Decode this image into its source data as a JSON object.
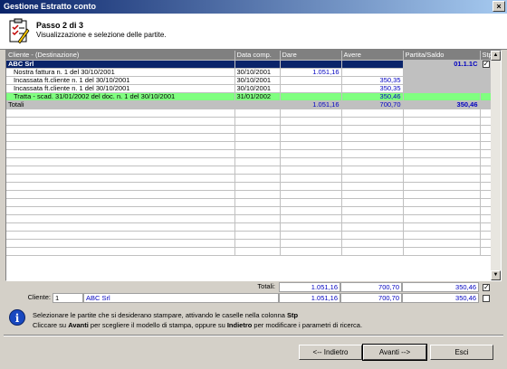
{
  "window": {
    "title": "Gestione Estratto conto",
    "close_label": "×"
  },
  "header": {
    "step_title": "Passo 2 di 3",
    "step_subtitle": "Visualizzazione e selezione delle partite."
  },
  "grid": {
    "columns": {
      "cliente": "Cliente - (Destinazione)",
      "data": "Data comp.",
      "dare": "Dare",
      "avere": "Avere",
      "saldo": "Partita/Saldo",
      "stp": "Stp"
    },
    "group": {
      "cliente": "ABC Srl",
      "saldo": "01.1.1C",
      "stp_checked": true
    },
    "rows": [
      {
        "cliente": "Nostra fattura n. 1 del 30/10/2001",
        "data": "30/10/2001",
        "dare": "1.051,16",
        "avere": "",
        "saldo": ""
      },
      {
        "cliente": "Incassata ft.cliente n. 1 del 30/10/2001",
        "data": "30/10/2001",
        "dare": "",
        "avere": "350,35",
        "saldo": ""
      },
      {
        "cliente": "Incassata ft.cliente n. 1 del 30/10/2001",
        "data": "30/10/2001",
        "dare": "",
        "avere": "350,35",
        "saldo": ""
      },
      {
        "cliente": "Tratta - scad. 31/01/2002 del doc. n. 1 del 30/10/2001",
        "data": "31/01/2002",
        "dare": "",
        "avere": "350,46",
        "saldo": ""
      }
    ],
    "totals": {
      "label": "Totali",
      "dare": "1.051,16",
      "avere": "700,70",
      "saldo": "350,46"
    }
  },
  "footer": {
    "totals_label": "Totali:",
    "totals_dare": "1.051,16",
    "totals_avere": "700,70",
    "totals_saldo": "350,46",
    "totals_checked": true,
    "cliente_label": "Cliente:",
    "cliente_code": "1",
    "cliente_name": "ABC Srl",
    "cliente_dare": "1.051,16",
    "cliente_avere": "700,70",
    "cliente_saldo": "350,46",
    "cliente_checked": false
  },
  "info": {
    "line1_pre": "Selezionare le partite che si desiderano stampare, attivando le caselle nella colonna ",
    "line1_bold": "Stp",
    "line2_a": "Cliccare su ",
    "line2_b": "Avanti",
    "line2_c": " per scegliere il modello di stampa, oppure su ",
    "line2_d": "Indietro",
    "line2_e": " per modificare i parametri di ricerca."
  },
  "buttons": {
    "back": "<-- Indietro",
    "next": "Avanti -->",
    "exit": "Esci"
  },
  "colors": {
    "selection": "#0a246a",
    "highlight_row": "#80ff80",
    "number": "#0000c0"
  }
}
